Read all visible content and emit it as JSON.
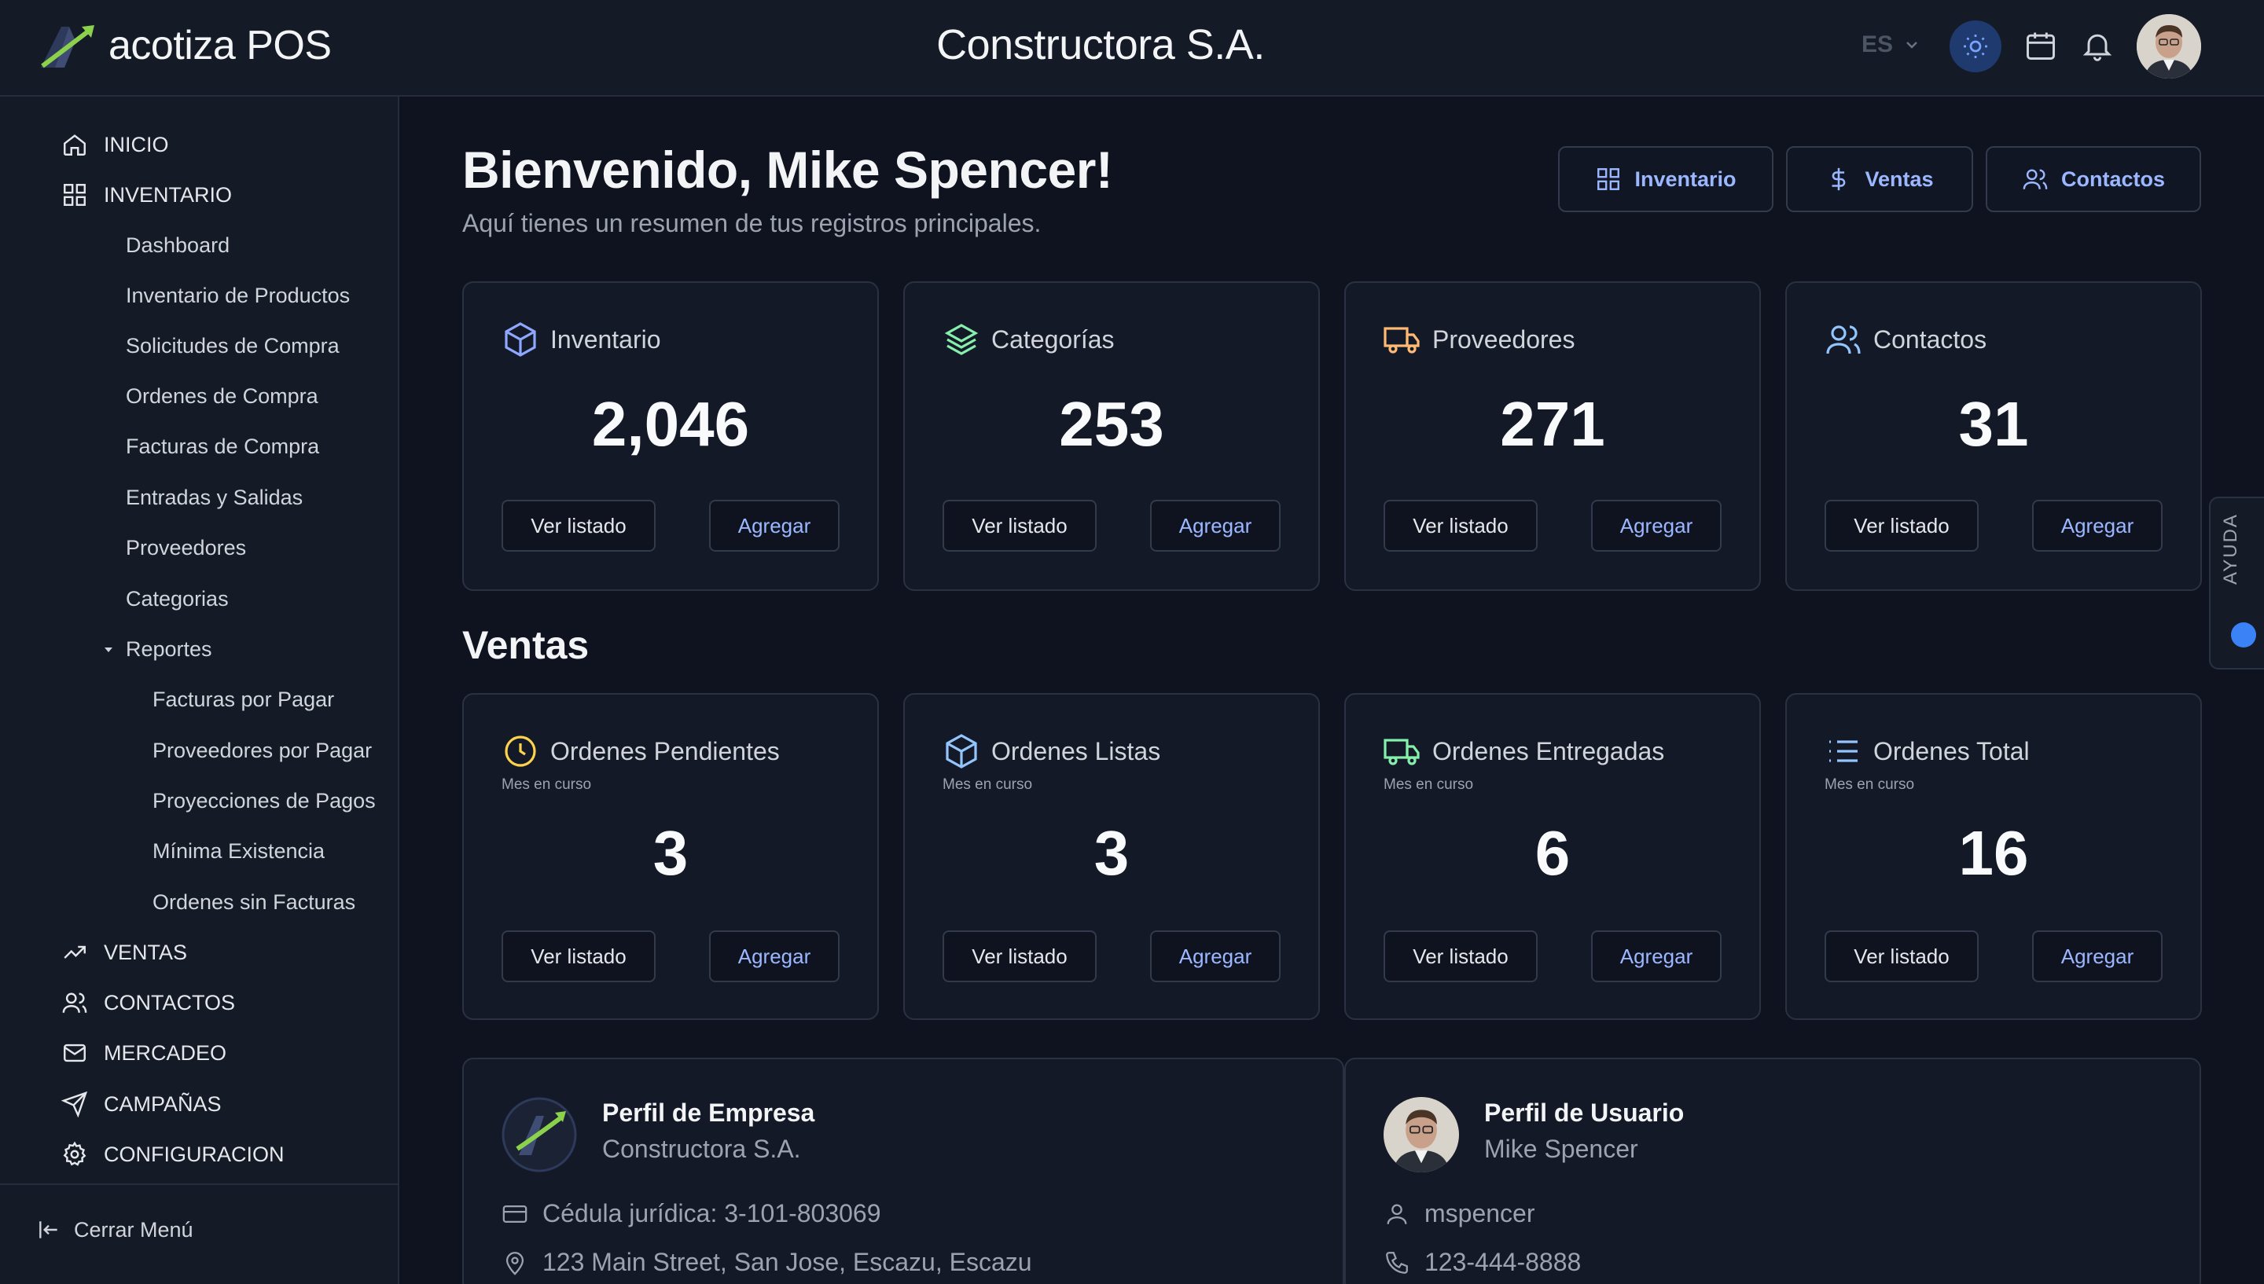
{
  "topbar": {
    "brand_name": "acotiza POS",
    "company_name": "Constructora S.A.",
    "language": "ES"
  },
  "sidebar": {
    "items": [
      {
        "label": "INICIO",
        "icon": "home-icon"
      },
      {
        "label": "INVENTARIO",
        "icon": "grid-icon"
      },
      {
        "label": "VENTAS",
        "icon": "trending-up-icon"
      },
      {
        "label": "CONTACTOS",
        "icon": "users-icon"
      },
      {
        "label": "MERCADEO",
        "icon": "mail-icon"
      },
      {
        "label": "CAMPAÑAS",
        "icon": "send-icon"
      },
      {
        "label": "CONFIGURACION",
        "icon": "gear-icon"
      }
    ],
    "inventario_sub": [
      "Dashboard",
      "Inventario de Productos",
      "Solicitudes de Compra",
      "Ordenes de Compra",
      "Facturas de Compra",
      "Entradas y Salidas",
      "Proveedores",
      "Categorias"
    ],
    "reportes_label": "Reportes",
    "reportes_sub": [
      "Facturas por Pagar",
      "Proveedores por Pagar",
      "Proyecciones de Pagos",
      "Mínima Existencia",
      "Ordenes sin Facturas"
    ],
    "collapse_label": "Cerrar Menú"
  },
  "main": {
    "welcome": "Bienvenido, Mike Spencer!",
    "subtitle": "Aquí tienes un resumen de tus registros principales.",
    "quick_links": [
      "Inventario",
      "Ventas",
      "Contactos"
    ],
    "summary_cards": [
      {
        "title": "Inventario",
        "value": "2,046",
        "icon": "box-icon",
        "color": "#8fa8ff"
      },
      {
        "title": "Categorías",
        "value": "253",
        "icon": "layers-icon",
        "color": "#86efac"
      },
      {
        "title": "Proveedores",
        "value": "271",
        "icon": "truck-icon",
        "color": "#fdba74"
      },
      {
        "title": "Contactos",
        "value": "31",
        "icon": "users-icon",
        "color": "#93c5fd"
      }
    ],
    "sales_title": "Ventas",
    "sales_cards": [
      {
        "title": "Ordenes Pendientes",
        "caption": "Mes en curso",
        "value": "3",
        "icon": "clock-icon",
        "color": "#fcd34d"
      },
      {
        "title": "Ordenes Listas",
        "caption": "Mes en curso",
        "value": "3",
        "icon": "box-icon",
        "color": "#93c5fd"
      },
      {
        "title": "Ordenes Entregadas",
        "caption": "Mes en curso",
        "value": "6",
        "icon": "truck-icon",
        "color": "#86efac"
      },
      {
        "title": "Ordenes Total",
        "caption": "Mes en curso",
        "value": "16",
        "icon": "list-icon",
        "color": "#93c5fd"
      }
    ],
    "btn_list": "Ver listado",
    "btn_add": "Agregar",
    "company_profile": {
      "title": "Perfil de Empresa",
      "name": "Constructora S.A.",
      "cedula": "Cédula jurídica: 3-101-803069",
      "address": "123 Main Street, San Jose, Escazu, Escazu"
    },
    "user_profile": {
      "title": "Perfil de Usuario",
      "name": "Mike Spencer",
      "username": "mspencer",
      "phone": "123-444-8888"
    }
  },
  "help": {
    "label": "AYUDA"
  }
}
